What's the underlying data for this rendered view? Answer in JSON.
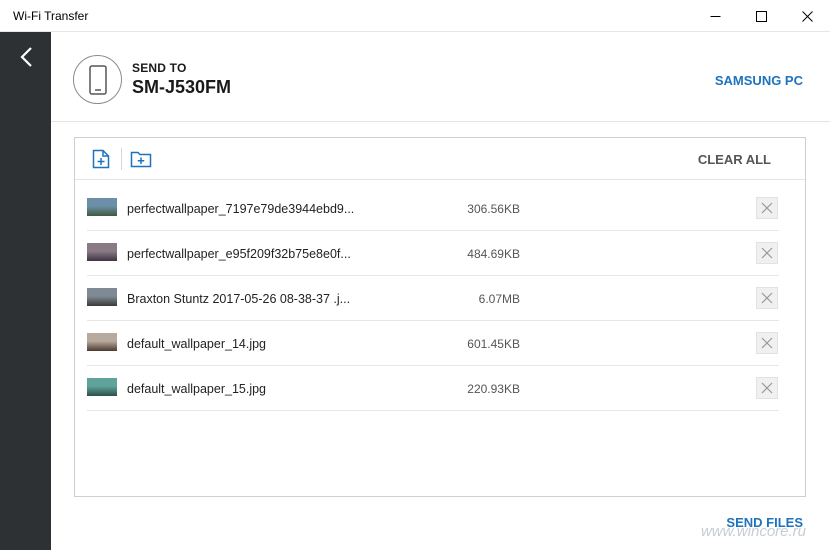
{
  "window": {
    "title": "Wi-Fi Transfer",
    "icons": {
      "minimize": "minimize-icon",
      "maximize": "maximize-icon",
      "close": "close-icon"
    }
  },
  "sidebar": {
    "back_icon": "chevron-left-icon"
  },
  "header": {
    "send_to_label": "SEND TO",
    "device_name": "SM-J530FM",
    "device_icon": "smartphone-icon",
    "pc_link": "SAMSUNG PC"
  },
  "toolbar": {
    "add_file_icon": "add-file-icon",
    "add_folder_icon": "add-folder-icon",
    "clear_all": "CLEAR ALL"
  },
  "files": [
    {
      "name": "perfectwallpaper_7197e79de3944ebd9...",
      "size": "306.56KB",
      "thumb_colors": [
        "#6b8fa8",
        "#3f5a3e"
      ]
    },
    {
      "name": "perfectwallpaper_e95f209f32b75e8e0f...",
      "size": "484.69KB",
      "thumb_colors": [
        "#8a7a86",
        "#3c3440"
      ]
    },
    {
      "name": "Braxton Stuntz  2017-05-26 08-38-37 .j...",
      "size": "6.07MB",
      "thumb_colors": [
        "#7f8a94",
        "#3a3a38"
      ]
    },
    {
      "name": "default_wallpaper_14.jpg",
      "size": "601.45KB",
      "thumb_colors": [
        "#b7a99b",
        "#4a3a30"
      ]
    },
    {
      "name": "default_wallpaper_15.jpg",
      "size": "220.93KB",
      "thumb_colors": [
        "#5fa39a",
        "#2d4f4a"
      ]
    }
  ],
  "footer": {
    "send_files": "SEND FILES"
  },
  "watermark": "www.wincore.ru",
  "colors": {
    "accent": "#1e73be",
    "sidebar": "#2d3134"
  }
}
